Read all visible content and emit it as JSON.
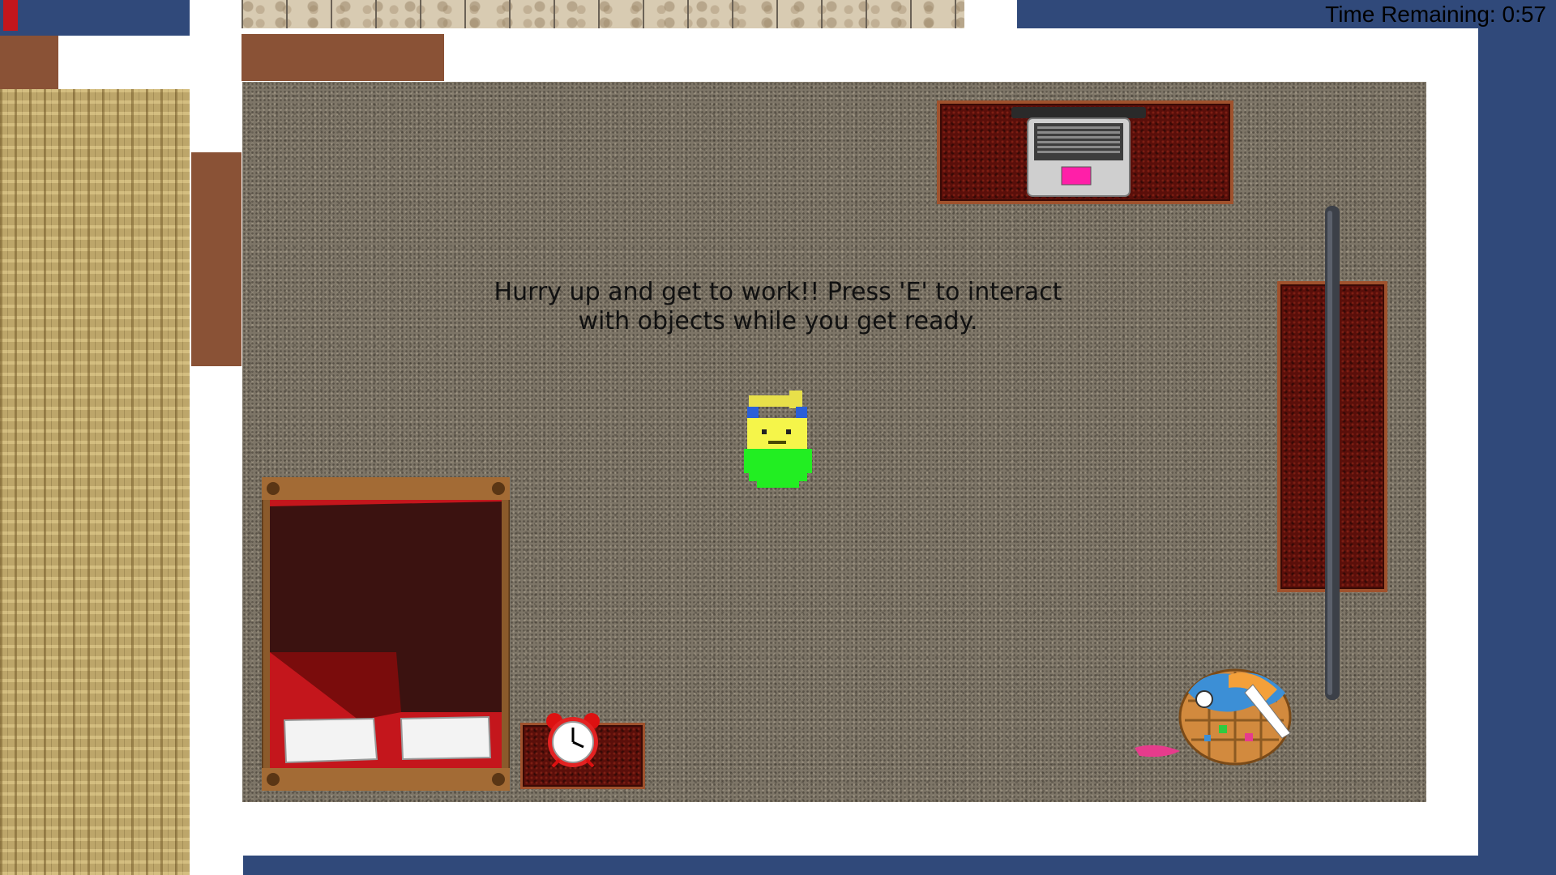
{
  "hud": {
    "timer_text": "Time Remaining: 0:57"
  },
  "scene": {
    "instruction_message": "Hurry up and get to work!! Press 'E' to interact with objects while you get ready."
  },
  "objects": [
    {
      "name": "laptop",
      "icon": "laptop-icon"
    },
    {
      "name": "tv",
      "icon": "tv-icon"
    },
    {
      "name": "bed",
      "icon": "bed-icon"
    },
    {
      "name": "alarm-clock",
      "icon": "alarm-clock-icon"
    },
    {
      "name": "laundry-basket",
      "icon": "laundry-basket-icon"
    },
    {
      "name": "player",
      "icon": "player-character-icon"
    }
  ],
  "colors": {
    "wall_navy": "#30497a",
    "door_brown": "#8a5236",
    "laptop_screen_accent": "#ff1fa8",
    "player_face": "#f5f54a",
    "player_body": "#22ee22",
    "player_ears": "#2a5fd8",
    "bed_sheet": "#c4161c"
  }
}
